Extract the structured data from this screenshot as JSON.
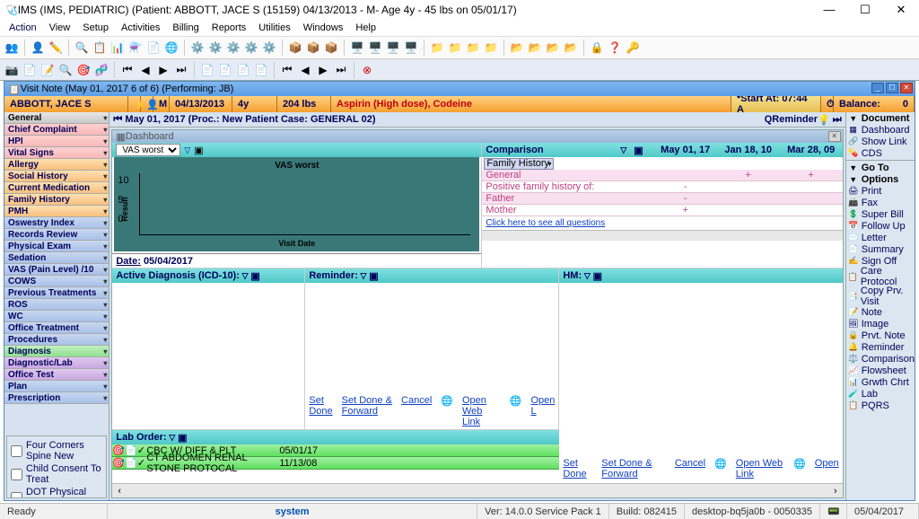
{
  "window": {
    "title": "IMS (IMS, PEDIATRIC)   (Patient: ABBOTT, JACE S (15159) 04/13/2013 - M- Age 4y  - 45 lbs on 05/01/17)"
  },
  "menu": [
    "Action",
    "View",
    "Setup",
    "Activities",
    "Billing",
    "Reports",
    "Utilities",
    "Windows",
    "Help"
  ],
  "visit_note_title": "Visit Note (May 01, 2017  6 of 6) (Performing: JB)",
  "patient_bar": {
    "name": "ABBOTT, JACE S",
    "sex": "M",
    "dob": "04/13/2013",
    "age": "4y",
    "weight": "204 lbs",
    "allergies": "Aspirin (High dose), Codeine",
    "start_at": "*Start At: 07:44 A",
    "balance_label": "Balance:",
    "balance_value": "0"
  },
  "left_nav": [
    {
      "label": "General",
      "cls": "gray-head"
    },
    {
      "label": "Chief Complaint",
      "cls": "pink"
    },
    {
      "label": "HPI",
      "cls": "pink"
    },
    {
      "label": "Vital Signs",
      "cls": "pink"
    },
    {
      "label": "Allergy",
      "cls": "orange-row"
    },
    {
      "label": "Social History",
      "cls": "orange-row"
    },
    {
      "label": "Current Medication",
      "cls": "orange-row"
    },
    {
      "label": "Family History",
      "cls": "orange-row"
    },
    {
      "label": "PMH",
      "cls": "orange-row"
    },
    {
      "label": "Oswestry Index",
      "cls": "blue-row"
    },
    {
      "label": "Records Review",
      "cls": "blue-row"
    },
    {
      "label": "Physical Exam",
      "cls": "blue-row"
    },
    {
      "label": "Sedation",
      "cls": "blue-row"
    },
    {
      "label": "VAS (Pain Level)  /10",
      "cls": "blue-row"
    },
    {
      "label": "COWS",
      "cls": "blue-row"
    },
    {
      "label": "Previous Treatments",
      "cls": "blue-row"
    },
    {
      "label": "ROS",
      "cls": "blue-row"
    },
    {
      "label": "WC",
      "cls": "blue-row"
    },
    {
      "label": "Office Treatment",
      "cls": "blue-row"
    },
    {
      "label": "Procedures",
      "cls": "blue-row"
    },
    {
      "label": "Diagnosis",
      "cls": "green-row"
    },
    {
      "label": "Diagnostic/Lab",
      "cls": "purple-row"
    },
    {
      "label": "Office Test",
      "cls": "purple-row"
    },
    {
      "label": "Plan",
      "cls": "blue-row"
    },
    {
      "label": "Prescription",
      "cls": "blue-row"
    }
  ],
  "forms": [
    "Four Corners Spine New",
    "Child Consent To Treat",
    "DOT Physical form"
  ],
  "top_info": "May 01, 2017  (Proc.: New Patient  Case: GENERAL 02)",
  "qreminder": "QReminder",
  "dashboard": {
    "title": "Dashboard",
    "chart_dropdown": "VAS worst",
    "chart_title": "VAS worst",
    "y_label": "Result",
    "x_label": "Visit Date",
    "date_label": "Date:",
    "date_value": "05/04/2017"
  },
  "comparison": {
    "title": "Comparison",
    "dates": [
      "May 01, 17",
      "Jan 18, 10",
      "Mar 28, 09"
    ],
    "dropdown": "Family History",
    "rows": [
      {
        "label": "General",
        "vals": [
          "",
          "+",
          "+"
        ]
      },
      {
        "label": "Positive family history of:",
        "vals": [
          "-",
          "",
          ""
        ]
      },
      {
        "label": "Father",
        "vals": [
          "-",
          "",
          ""
        ]
      },
      {
        "label": "Mother",
        "vals": [
          "+",
          "",
          ""
        ]
      }
    ],
    "see_all": "Click here to see all questions"
  },
  "subpanels": {
    "active_dx": "Active Diagnosis (ICD-10):",
    "reminder": "Reminder:",
    "hm": "HM:",
    "links": {
      "set_done": "Set Done",
      "set_done_fwd": "Set Done & Forward",
      "cancel": "Cancel",
      "open_web": "Open Web Link",
      "open": "Open L"
    },
    "hm_links": {
      "set_done": "Set Done",
      "set_done_fwd": "Set Done & Forward",
      "cancel": "Cancel",
      "open_web": "Open Web Link",
      "open": "Open"
    }
  },
  "lab_order": {
    "title": "Lab Order:",
    "rows": [
      {
        "name": "CBC W/ DIFF & PLT",
        "date": "05/01/17"
      },
      {
        "name": "CT ABDOMEN RENAL STONE PROTOCAL",
        "date": "11/13/08"
      }
    ]
  },
  "right_menu": {
    "document": "Document",
    "dashboard": "Dashboard",
    "show_link": "Show Link",
    "cds": "CDS",
    "goto": "Go To",
    "options": "Options",
    "print": "Print",
    "fax": "Fax",
    "superbill": "Super Bill",
    "followup": "Follow Up",
    "letter": "Letter",
    "summary": "Summary",
    "signoff": "Sign Off",
    "care": "Care Protocol",
    "copy": "Copy Prv. Visit",
    "note": "Note",
    "image": "Image",
    "prvtnote": "Prvt. Note",
    "reminder": "Reminder",
    "comparison": "Comparison",
    "flowsheet": "Flowsheet",
    "growth": "Grwth Chrt",
    "lab": "Lab",
    "pqrs": "PQRS"
  },
  "status": {
    "ready": "Ready",
    "system": "system",
    "ver": "Ver: 14.0.0 Service Pack 1",
    "build": "Build: 082415",
    "desktop": "desktop-bq5ja0b - 0050335",
    "date": "05/04/2017"
  },
  "chart_data": {
    "type": "line",
    "title": "VAS worst",
    "xlabel": "Visit Date",
    "ylabel": "Result",
    "ylim": [
      0,
      10
    ],
    "yticks": [
      0,
      5,
      10
    ],
    "categories": [],
    "values": []
  }
}
